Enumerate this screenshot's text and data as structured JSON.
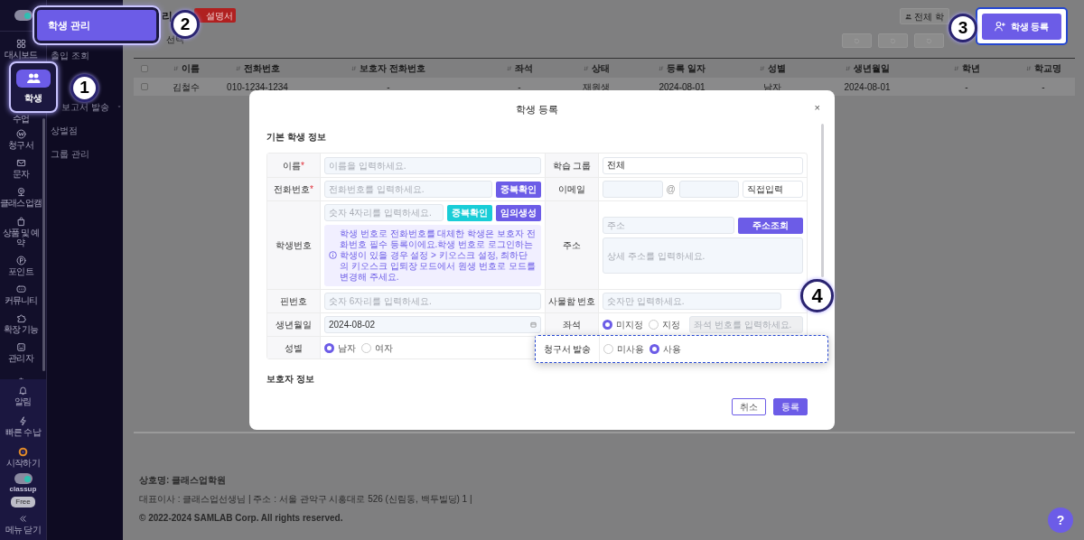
{
  "rail": {
    "items": [
      {
        "label": "대시보드",
        "selected": false
      },
      {
        "label": "학생",
        "selected": true
      },
      {
        "label": "수업",
        "selected": false
      },
      {
        "label": "청구서",
        "selected": false
      },
      {
        "label": "문자",
        "selected": false
      },
      {
        "label": "클래스업캠",
        "selected": false
      },
      {
        "label": "상품 및 예약",
        "selected": false
      },
      {
        "label": "포인트",
        "selected": false
      },
      {
        "label": "커뮤니티",
        "selected": false
      },
      {
        "label": "확장 기능",
        "selected": false
      },
      {
        "label": "관리자",
        "selected": false
      },
      {
        "selected": false
      }
    ],
    "bottom_items": [
      {
        "label": "알림"
      },
      {
        "label": "빠른 수납"
      },
      {
        "label": "시작하기"
      }
    ],
    "brand": "classup",
    "plan": "Free",
    "collapse": "메뉴 닫기"
  },
  "submenu": {
    "title": "학생 관리",
    "items": [
      {
        "label": "출입 조회",
        "expandable": false
      },
      {
        "label": "보고서 발송",
        "expandable": true
      },
      {
        "label": "상벌점",
        "expandable": false
      },
      {
        "label": "그룹 관리",
        "expandable": false
      }
    ]
  },
  "header": {
    "title": "리",
    "manual": "설명서",
    "selection": "선택",
    "total": "전체 학",
    "register": "학생 등록"
  },
  "table": {
    "header_checked": false,
    "columns": [
      "이름",
      "전화번호",
      "보호자 전화번호",
      "좌석",
      "상태",
      "등록 일자",
      "성별",
      "생년월일",
      "학년",
      "학교명"
    ],
    "rows": [
      {
        "checked": false,
        "cells": [
          "김철수",
          "010-1234-1234",
          "-",
          "-",
          "재원생",
          "2024-08-01",
          "남자",
          "2024-08-01",
          "-",
          "-"
        ]
      }
    ]
  },
  "footer": {
    "lines": [
      "상호명: 클래스업학원",
      "대표이사 : 클래스업선생님 | 주소 : 서울 관악구 시흥대로 526 (신림동, 백두빌딩) 1 |",
      "© 2022-2024 SAMLAB Corp. All rights reserved."
    ]
  },
  "help": "?",
  "callouts": [
    "1",
    "2",
    "3",
    "4"
  ],
  "modal": {
    "title": "학생 등록",
    "close": "×",
    "section": "기본 학생 정보",
    "section_2": "보호자 정보",
    "rows": [
      {
        "left": {
          "label": "이름",
          "mark": "*",
          "kind": "text",
          "placeholder": "이름을 입력하세요."
        },
        "right": {
          "label": "학습 그룹",
          "kind": "text",
          "value": "전체"
        }
      },
      {
        "left": {
          "label": "전화번호",
          "mark": "*",
          "kind": "text_button",
          "placeholder": "전화번호를 입력하세요.",
          "buttons": [
            {
              "label": "중복확인"
            }
          ]
        },
        "right": {
          "label": "이메일",
          "kind": "email",
          "separator": "@",
          "domain": "직접입력"
        }
      },
      {
        "left": {
          "label": "학생번호",
          "kind": "text_button",
          "placeholder": "숫자 4자리를 입력하세요.",
          "buttons": [
            {
              "label": "중복확인"
            },
            {
              "label": "임의생성"
            }
          ],
          "note": "학생 번호로 전화번호를 대체한 학생은 보호자 전화번호 필수 등록이에요.학생 번호로 로그인하는 학생이 있을 경우 설정 > 키오스크 설정, 최하단의 키오스크 입퇴장 모드에서 원생 번호로 모드를 변경해 주세요."
        },
        "right": {
          "label": "주소",
          "kind": "address",
          "placeholder": "주소",
          "button": "주소조회",
          "detail_placeholder": "상세 주소를 입력하세요."
        }
      },
      {
        "left": {
          "label": "핀번호",
          "kind": "text",
          "placeholder": "숫자 6자리를 입력하세요."
        },
        "right": {
          "label": "사물함 번호",
          "kind": "text",
          "placeholder": "숫자만 입력하세요."
        }
      },
      {
        "left": {
          "label": "생년월일",
          "kind": "date",
          "value": "2024-08-02"
        },
        "right": {
          "label": "좌석",
          "kind": "radio",
          "options": [
            {
              "label": "미지정",
              "selected": true
            },
            {
              "label": "지정",
              "selected": false
            }
          ],
          "input_placeholder": "좌석 번호를 입력하세요.",
          "input_disabled": true
        }
      },
      {
        "left": {
          "label": "성별",
          "kind": "radio",
          "options": [
            {
              "label": "남자",
              "selected": true
            },
            {
              "label": "여자",
              "selected": false
            }
          ]
        },
        "right": {
          "label": "청구서 발송",
          "kind": "radio",
          "highlighted": true,
          "options": [
            {
              "label": "미사용",
              "selected": false
            },
            {
              "label": "사용",
              "selected": true
            }
          ]
        }
      }
    ],
    "buttons": [
      {
        "label": "취소"
      },
      {
        "label": "등록"
      }
    ]
  }
}
